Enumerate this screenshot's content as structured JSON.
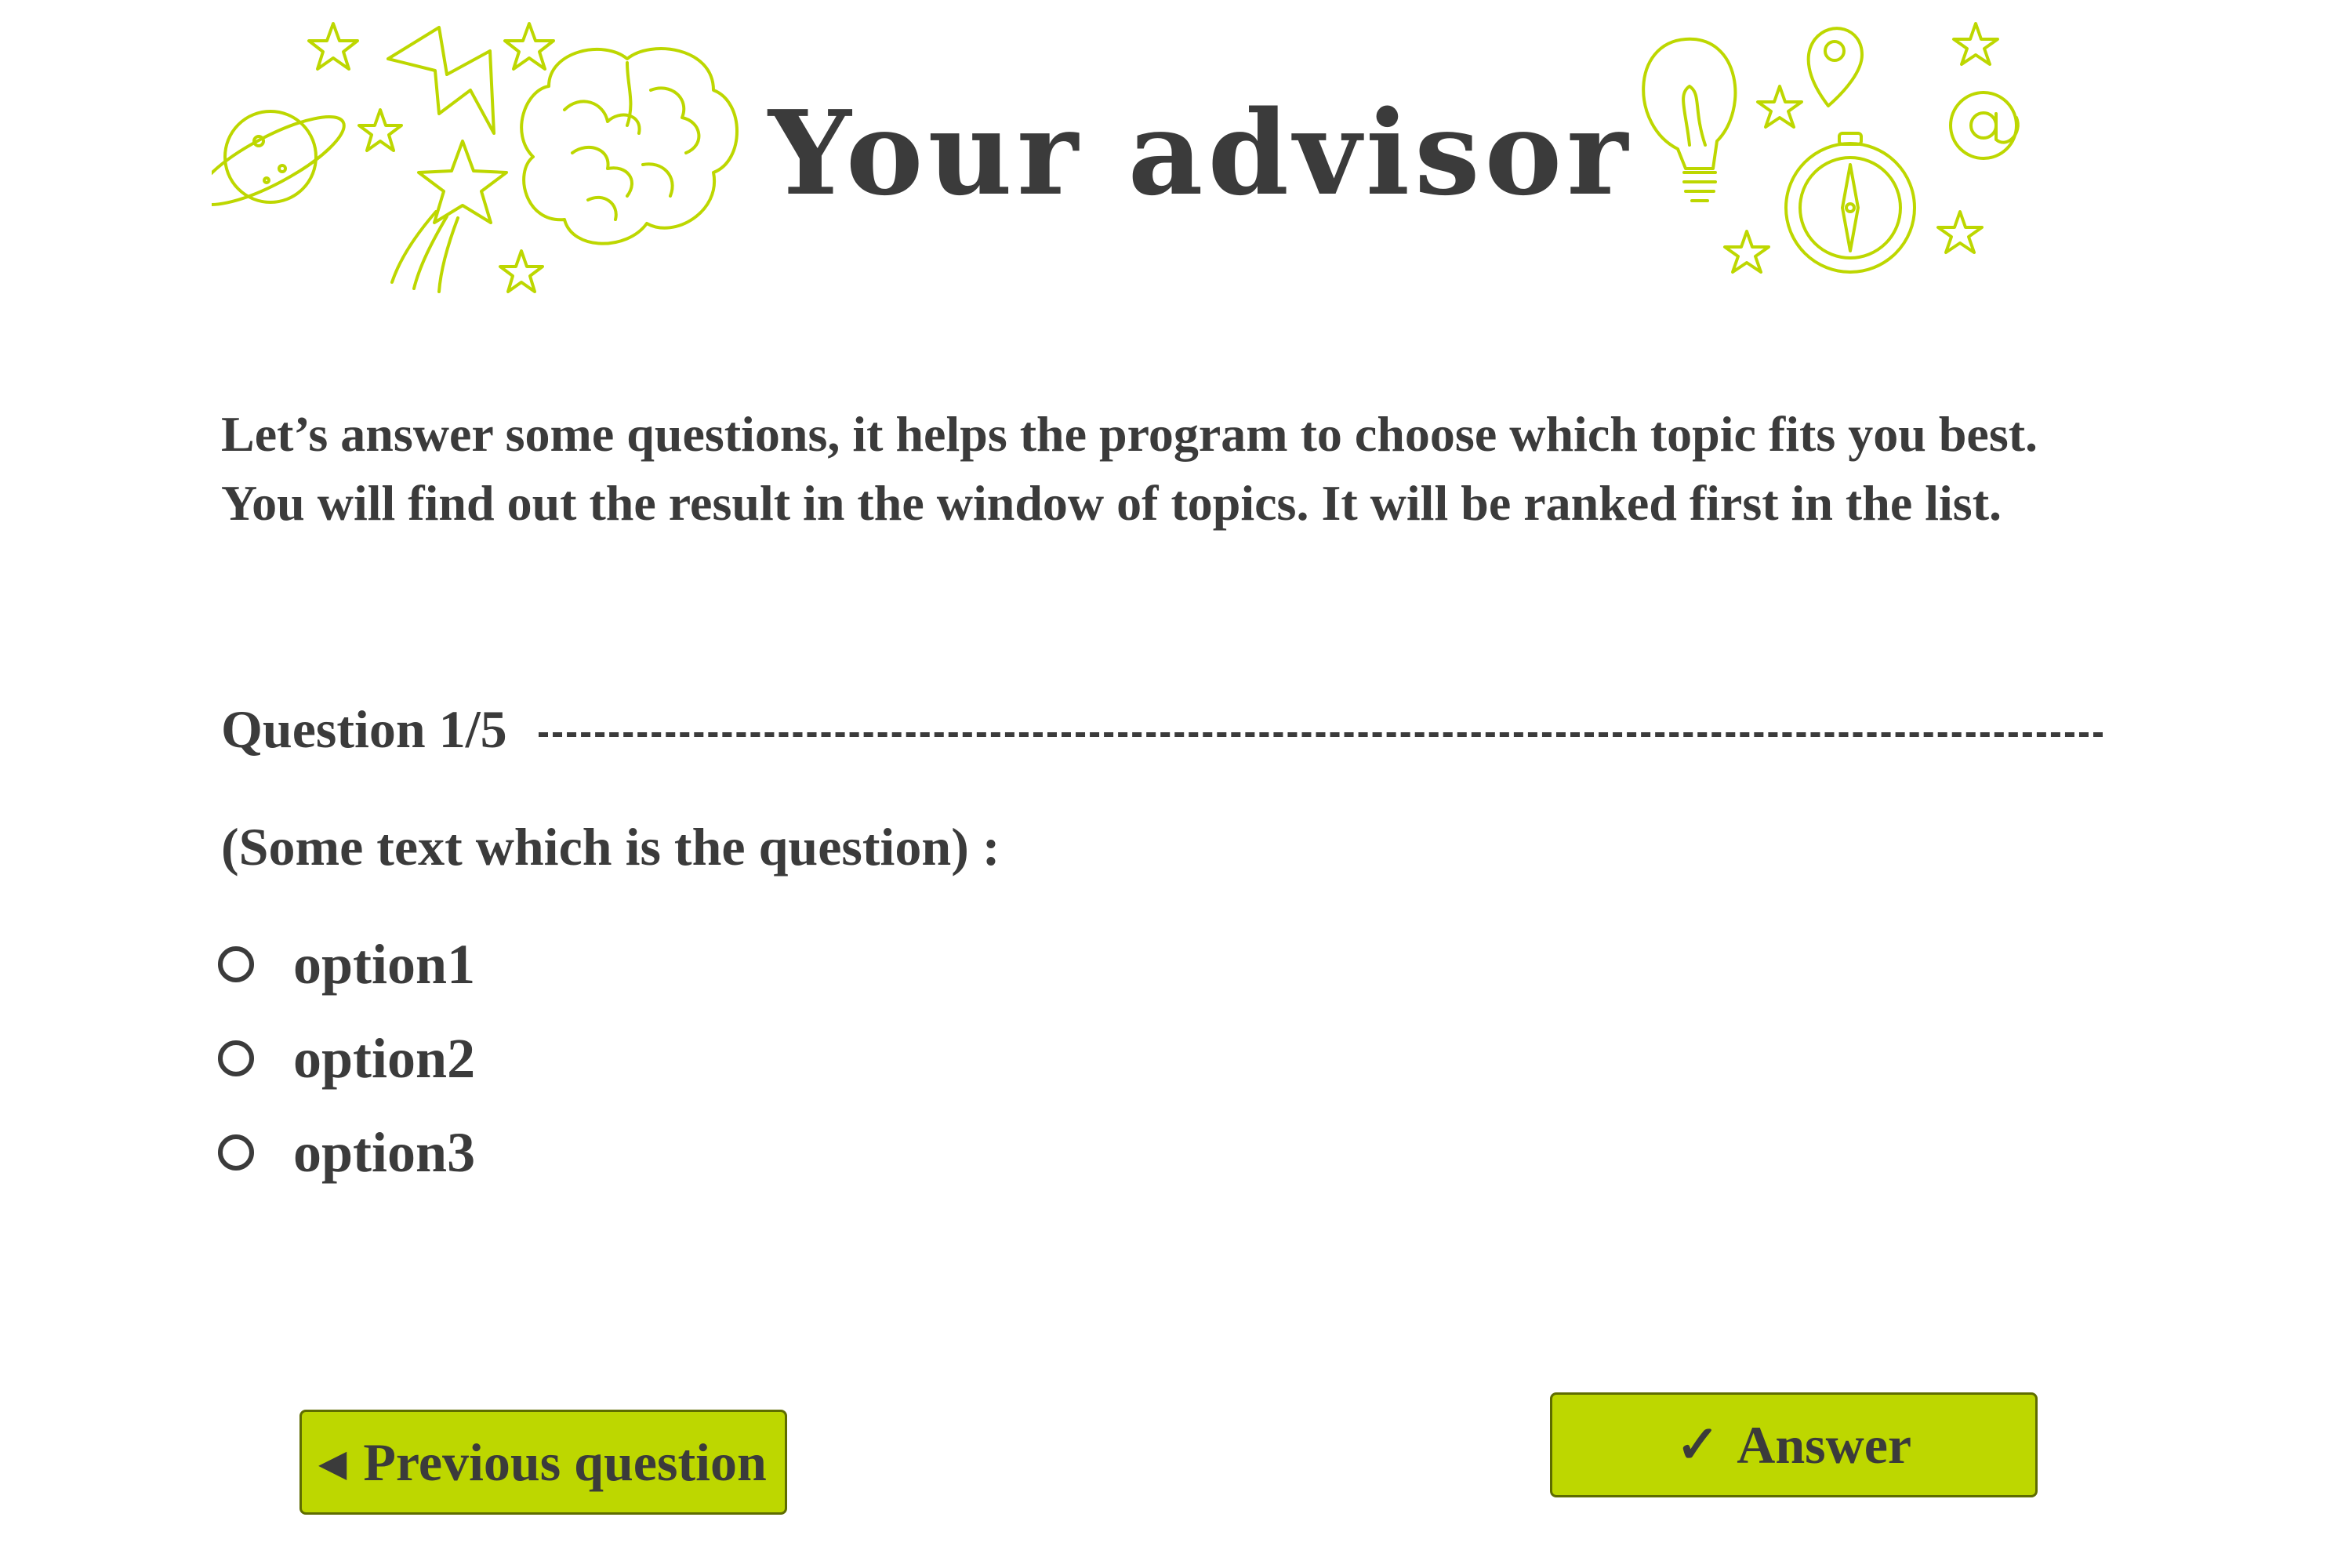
{
  "header": {
    "title": "Your advisor",
    "left_icons": [
      "planet-icon",
      "lightning-icon",
      "shooting-star-icon",
      "brain-icon",
      "star-icon"
    ],
    "right_icons": [
      "lightbulb-icon",
      "map-pin-icon",
      "compass-icon",
      "at-sign-icon",
      "star-icon"
    ]
  },
  "intro": {
    "line1": "Let’s answer some questions, it helps the program to choose which topic fits you best.",
    "line2": "You will find out the result in the window of topics. It will be ranked first in the list."
  },
  "question": {
    "counter": "Question 1/5",
    "text": "(Some text which is the question) :",
    "options": [
      {
        "label": "option1",
        "selected": false
      },
      {
        "label": "option2",
        "selected": false
      },
      {
        "label": "option3",
        "selected": false
      }
    ]
  },
  "buttons": {
    "previous": {
      "icon": "arrow-left-icon",
      "label": "Previous question"
    },
    "answer": {
      "icon": "checkmark-icon",
      "label": "Answer"
    }
  },
  "colors": {
    "accent": "#bdd700",
    "accent_border": "#5e6c00",
    "text": "#3b3b3b",
    "background": "#ffffff"
  }
}
